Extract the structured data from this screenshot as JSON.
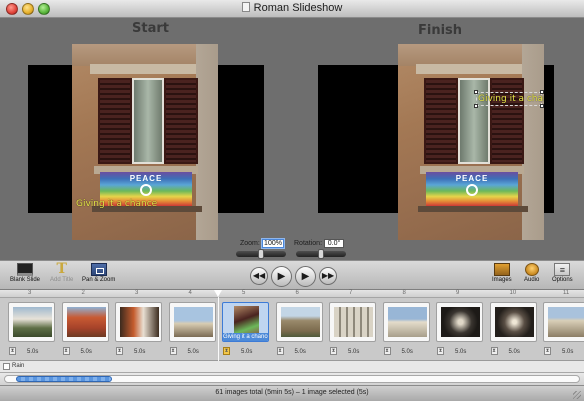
{
  "window": {
    "title": "Roman Slideshow"
  },
  "preview": {
    "start_label": "Start",
    "finish_label": "Finish",
    "caption_text": "Giving it a chance",
    "flag_text": "PEACE",
    "zoom_label": "Zoom:",
    "zoom_value": "100%",
    "rotation_label": "Rotation:",
    "rotation_value": "0.0°"
  },
  "toolbar": {
    "blank_slide": "Blank Slide",
    "add_title": "Add Title",
    "pan_zoom": "Pan & Zoom",
    "prev": "◀◀",
    "play": "▶",
    "play_full": "▶",
    "next": "▶▶",
    "images": "Images",
    "audio": "Audio",
    "options": "Options",
    "options_glyph": "≡"
  },
  "timeline": {
    "slides": [
      {
        "number": "3",
        "duration": "5.0s",
        "caption": ""
      },
      {
        "number": "2",
        "duration": "5.0s",
        "caption": ""
      },
      {
        "number": "3",
        "duration": "5.0s",
        "caption": ""
      },
      {
        "number": "4",
        "duration": "5.0s",
        "caption": ""
      },
      {
        "number": "5",
        "duration": "5.0s",
        "caption": "Giving it a chance"
      },
      {
        "number": "6",
        "duration": "5.0s",
        "caption": ""
      },
      {
        "number": "7",
        "duration": "5.0s",
        "caption": ""
      },
      {
        "number": "8",
        "duration": "5.0s",
        "caption": ""
      },
      {
        "number": "9",
        "duration": "5.0s",
        "caption": ""
      },
      {
        "number": "10",
        "duration": "5.0s",
        "caption": ""
      },
      {
        "number": "11",
        "duration": "5.0s",
        "caption": ""
      }
    ],
    "selected_index": 4
  },
  "audio_track": {
    "label": "Rain"
  },
  "status": {
    "text": "61 images total (5min 5s)  –  1 image selected (5s)"
  },
  "colors": {
    "accent": "#4d8ad8",
    "caption_yellow": "#e9e84a",
    "selection": "#bfd5f0"
  },
  "icons": {
    "blank_slide": "blank-slide-icon",
    "add_title": "title-T-icon",
    "pan_zoom": "pan-zoom-icon",
    "images": "images-icon",
    "audio": "audio-note-icon",
    "options": "options-icon"
  }
}
